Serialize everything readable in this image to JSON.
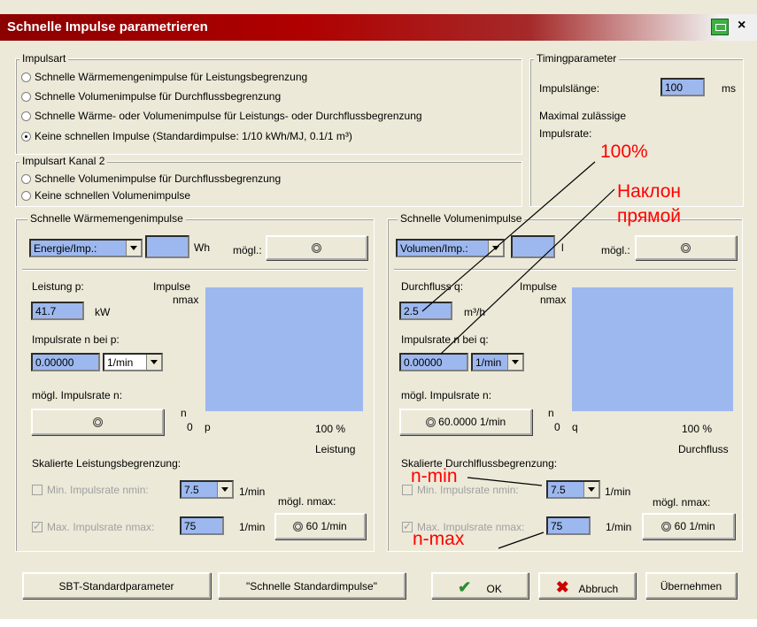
{
  "window": {
    "title": "Schnelle Impulse parametrieren",
    "close": "×"
  },
  "impulsart": {
    "legend": "Impulsart",
    "options": [
      "Schnelle Wärmemengenimpulse für Leistungsbegrenzung",
      "Schnelle Volumenimpulse für Durchflussbegrenzung",
      "Schnelle Wärme- oder Volumenimpulse für Leistungs- oder Durchflussbegrenzung",
      "Keine schnellen Impulse (Standardimpulse: 1/10 kWh/MJ, 0.1/1 m³)"
    ],
    "selected": 3
  },
  "kanal2": {
    "legend": "Impulsart Kanal 2",
    "options": [
      "Schnelle Volumenimpulse für Durchflussbegrenzung",
      "Keine schnellen Volumenimpulse"
    ]
  },
  "timing": {
    "legend": "Timingparameter",
    "impulslaenge_label": "Impulslänge:",
    "impulslaenge_value": "100",
    "impulslaenge_unit": "ms",
    "max_rate_label_1": "Maximal zulässige",
    "max_rate_label_2": "Impulsrate:"
  },
  "waerme": {
    "legend": "Schnelle Wärmemengenimpulse",
    "energie_select": "Energie/Imp.:",
    "energie_unit": "Wh",
    "moegl_label": "mögl.:",
    "leistung_label": "Leistung p:",
    "leistung_value": "41.7",
    "leistung_unit": "kW",
    "impulse_label": "Impulse",
    "nmax_label": "nmax",
    "impulsrate_label": "Impulsrate n bei p:",
    "impulsrate_value": "0.00000",
    "impulsrate_unit": "1/min",
    "moegl_impulsrate_label": "mögl. Impulsrate n:",
    "n_label": "n",
    "zero_label": "0",
    "p_label": "p",
    "hundred_label": "100 %",
    "axis_label": "Leistung",
    "skaliert_label": "Skalierte Leistungsbegrenzung:",
    "min_label": "Min. Impulsrate nmin:",
    "min_value": "7.5",
    "min_unit": "1/min",
    "moegl_nmax_label": "mögl. nmax:",
    "max_label": "Max. Impulsrate nmax:",
    "max_value": "75",
    "max_unit": "1/min",
    "nmax_button": "60 1/min"
  },
  "volumen": {
    "legend": "Schnelle Volumenimpulse",
    "volumen_select": "Volumen/Imp.:",
    "volumen_unit": "l",
    "moegl_label": "mögl.:",
    "durchfluss_label": "Durchfluss q:",
    "durchfluss_value": "2.5",
    "durchfluss_unit": "m³/h",
    "impulse_label": "Impulse",
    "nmax_label": "nmax",
    "impulsrate_label": "Impulsrate n bei q:",
    "impulsrate_value": "0.00000",
    "impulsrate_unit": "1/min",
    "moegl_impulsrate_label": "mögl. Impulsrate n:",
    "moegl_impulsrate_button": "60.0000 1/min",
    "n_label": "n",
    "zero_label": "0",
    "q_label": "q",
    "hundred_label": "100 %",
    "axis_label": "Durchfluss",
    "skaliert_label": "Skalierte Durchlflussbegrenzung:",
    "min_label": "Min. Impulsrate nmin:",
    "min_value": "7.5",
    "min_unit": "1/min",
    "moegl_nmax_label": "mögl. nmax:",
    "max_label": "Max. Impulsrate nmax:",
    "max_value": "75",
    "max_unit": "1/min",
    "nmax_button": "60 1/min"
  },
  "buttons": {
    "sbt": "SBT-Standardparameter",
    "schnelle": "\"Schnelle Standardimpulse\"",
    "ok": "OK",
    "abbruch": "Abbruch",
    "uebernehmen": "Übernehmen"
  },
  "annotations": {
    "a100": "100%",
    "naklon1": "Наклон",
    "naklon2": "прямой",
    "nmin": "n-min",
    "nmax": "n-max"
  },
  "colors": {
    "field_blue": "#9db8ef",
    "title_red": "#8b0000",
    "annotation": "#ff0000",
    "ok_check": "#2e8b2e",
    "abbruch_x": "#cc0000"
  }
}
